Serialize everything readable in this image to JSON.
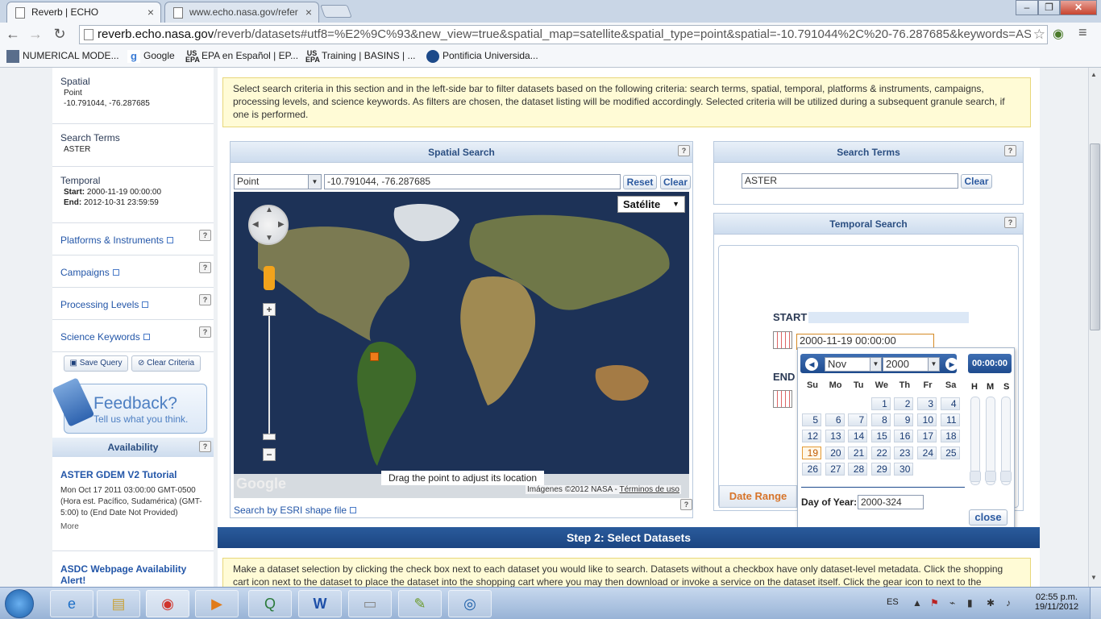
{
  "browser": {
    "tabs": [
      {
        "label": "Reverb | ECHO",
        "active": true
      },
      {
        "label": "www.echo.nasa.gov/refer",
        "active": false
      }
    ],
    "url_host": "reverb.echo.nasa.gov",
    "url_path": "/reverb/datasets#utf8=%E2%9C%93&new_view=true&spatial_map=satellite&spatial_type=point&spatial=-10.791044%2C%20-76.287685&keywords=AST",
    "bookmarks": [
      {
        "label": "NUMERICAL MODE...",
        "icon": "folder-icon"
      },
      {
        "label": "Google",
        "icon": "google-icon"
      },
      {
        "label": "EPA en Español | EP...",
        "icon": "epa-icon"
      },
      {
        "label": "Training | BASINS | ...",
        "icon": "epa-icon"
      },
      {
        "label": "Pontificia Universida...",
        "icon": "pucp-icon"
      }
    ]
  },
  "sidebar": {
    "spatial": {
      "heading": "Spatial",
      "type": "Point",
      "value": "-10.791044, -76.287685"
    },
    "search_terms": {
      "heading": "Search Terms",
      "value": "ASTER"
    },
    "temporal": {
      "heading": "Temporal",
      "start_label": "Start:",
      "start": "2000-11-19 00:00:00",
      "end_label": "End:",
      "end": "2012-10-31 23:59:59"
    },
    "links": [
      "Platforms & Instruments",
      "Campaigns",
      "Processing Levels",
      "Science Keywords"
    ],
    "help": "?",
    "save_query": "Save Query",
    "clear_criteria": "Clear Criteria",
    "feedback_title": "Feedback?",
    "feedback_sub": "Tell us what you think.",
    "availability_heading": "Availability",
    "avail_items": [
      {
        "title": "ASTER GDEM V2 Tutorial",
        "body": "Mon Oct 17 2011 03:00:00 GMT-0500 (Hora est. Pacífico, Sudamérica) (GMT-5:00) to (End Date Not Provided)",
        "more": "More"
      },
      {
        "title": "ASDC Webpage Availability Alert!"
      }
    ]
  },
  "info_text": "Select search criteria in this section and in the left-side bar to filter datasets based on the following criteria: search terms, spatial, temporal, platforms & instruments, campaigns, processing levels, and science keywords. As filters are chosen, the dataset listing will be modified accordingly. Selected criteria will be utilized during a subsequent granule search, if one is performed.",
  "spatial_search": {
    "title": "Spatial Search",
    "type_value": "Point",
    "coords": "-10.791044, -76.287685",
    "reset": "Reset",
    "clear": "Clear",
    "map_type": "Satélite",
    "drag_hint": "Drag the point to adjust its location",
    "attribution": "Imágenes ©2012 NASA - ",
    "terms": "Términos de uso",
    "google": "Google",
    "esri": "Search by ESRI shape file"
  },
  "search_terms_panel": {
    "title": "Search Terms",
    "value": "ASTER",
    "clear": "Clear"
  },
  "temporal_panel": {
    "title": "Temporal Search",
    "start_label": "START",
    "start_value": "2000-11-19 00:00:00",
    "end_label": "END",
    "date_range_tab": "Date Range"
  },
  "calendar": {
    "month": "Nov",
    "year": "2000",
    "time": "00:00:00",
    "weekdays": [
      "Su",
      "Mo",
      "Tu",
      "We",
      "Th",
      "Fr",
      "Sa"
    ],
    "hms": [
      "H",
      "M",
      "S"
    ],
    "days": [
      "1",
      "2",
      "3",
      "4",
      "5",
      "6",
      "7",
      "8",
      "9",
      "10",
      "11",
      "12",
      "13",
      "14",
      "15",
      "16",
      "17",
      "18",
      "19",
      "20",
      "21",
      "22",
      "23",
      "24",
      "25",
      "26",
      "27",
      "28",
      "29",
      "30"
    ],
    "current_day": "19",
    "doy_label": "Day of Year:",
    "doy_value": "2000-324",
    "close": "close"
  },
  "step2": "Step 2: Select Datasets",
  "info_text2": "Make a dataset selection by clicking the check box next to each dataset you would like to search. Datasets without a checkbox have only dataset-level metadata. Click the shopping cart icon next to the dataset to place the dataset into the shopping cart where you may then download or invoke a service on the dataset itself. Click the gear icon to next to the",
  "taskbar": {
    "lang": "ES",
    "time": "02:55 p.m.",
    "date": "19/11/2012"
  },
  "colors": {
    "accent": "#2b4f82",
    "step_bar": "#1b4582",
    "info_bg": "#fffbd6",
    "marker": "#f07c1a"
  }
}
